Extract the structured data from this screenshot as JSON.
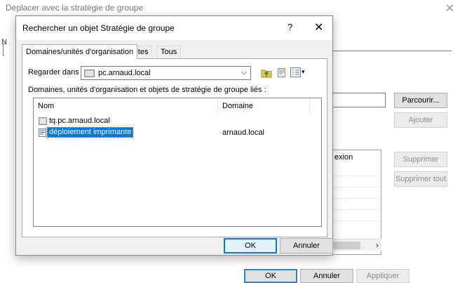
{
  "background_window": {
    "title": "Déplacer avec la stratégie de groupe",
    "close_symbol": "✕",
    "partial_letter": "N",
    "partial_column_text": "exion",
    "buttons": {
      "browse": "Parcourir...",
      "add": "Ajouter",
      "remove": "Supprimer",
      "remove_all": "Supprimer tout",
      "ok": "OK",
      "cancel": "Annuler",
      "apply": "Appliquer"
    },
    "scroll_right_symbol": "›"
  },
  "dialog": {
    "title": "Rechercher un objet Stratégie de groupe",
    "help_symbol": "?",
    "close_symbol": "✕",
    "tabs": [
      {
        "label": "Domaines/unités d'organisation",
        "active": true
      },
      {
        "label": "Sites",
        "active": false
      },
      {
        "label": "Tous",
        "active": false
      }
    ],
    "look_in": {
      "label": "Regarder dans :",
      "value": "pc.arnaud.local",
      "dropdown_symbol": "⌵"
    },
    "toolbar_icons": [
      "up-folder-icon",
      "new-gpo-icon",
      "view-menu-icon"
    ],
    "view_menu_arrow": "▾",
    "list_caption": "Domaines, unités d'organisation et objets de stratégie de groupe liés :",
    "columns": [
      "Nom",
      "Domaine"
    ],
    "rows": [
      {
        "name": "tq.pc.arnaud.local",
        "domain": "",
        "icon": "ou-folder-icon",
        "selected": false
      },
      {
        "name": "déploiement imprimante",
        "domain": "arnaud.local",
        "icon": "gpo-icon",
        "selected": true
      }
    ],
    "buttons": {
      "ok": "OK",
      "cancel": "Annuler"
    }
  },
  "colors": {
    "selection": "#0078d7",
    "dialog_face": "#f0f0f0",
    "button_face": "#e1e1e1",
    "disabled_text": "#8f8f8f"
  }
}
